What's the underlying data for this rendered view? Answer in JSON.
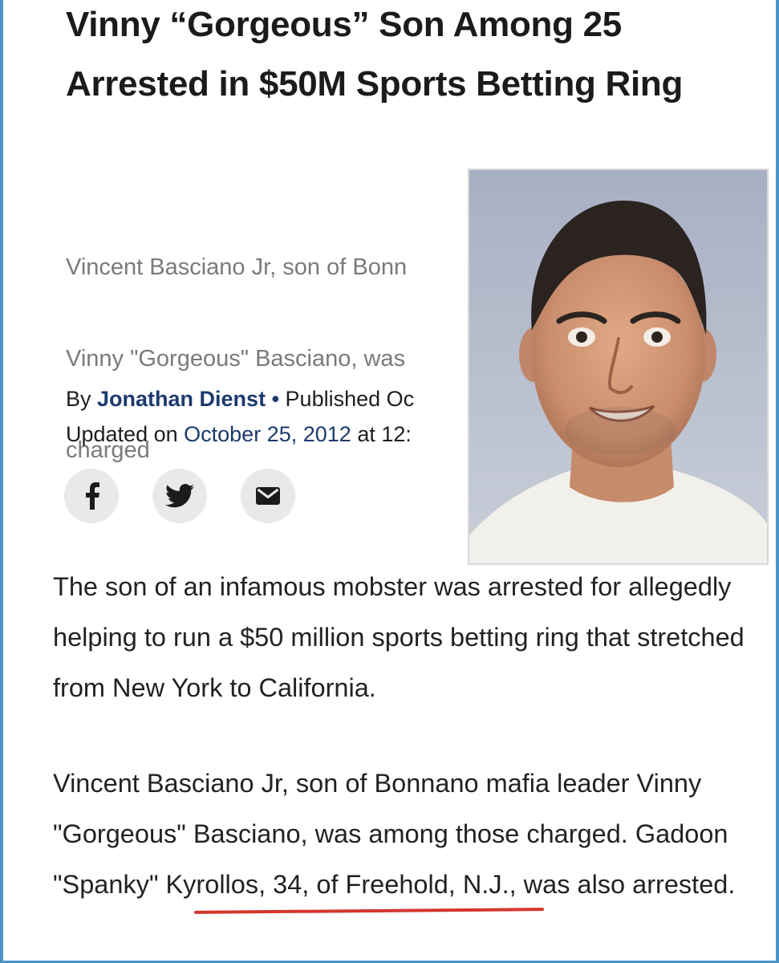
{
  "article": {
    "headline": "Vinny “Gorgeous” Son Among 25 Arrested in $50M Sports Betting Ring",
    "dek_lines": {
      "line1": "Vincent Basciano Jr, son of Bonn",
      "line2": "Vinny \"Gorgeous\" Basciano, was",
      "line3": "charged"
    },
    "byline": {
      "by_label": "By",
      "author": "Jonathan Dienst",
      "separator": "•",
      "published_label": "Published Oc",
      "updated_label": "Updated on",
      "updated_date": "October 25, 2012",
      "updated_time": "at 12:"
    },
    "share": {
      "facebook_icon": "facebook-icon",
      "twitter_icon": "twitter-icon",
      "email_icon": "email-icon"
    },
    "paragraphs": {
      "p1": "The son of an infamous mobster was arrested for allegedly helping to run a $50 million sports betting ring that stretched from New York to California.",
      "p2": "Vincent Basciano Jr, son of Bonnano mafia leader Vinny \"Gorgeous\" Basciano, was among those charged. Gadoon \"Spanky\" Kyrollos, 34, of Freehold, N.J., was also arrested."
    }
  },
  "colors": {
    "link": "#1d3a6e",
    "dek_gray": "#7a7a7a",
    "annotation_red": "#d5362d",
    "frame_blue": "#4a93c9",
    "share_bg": "#e9e9e9"
  }
}
